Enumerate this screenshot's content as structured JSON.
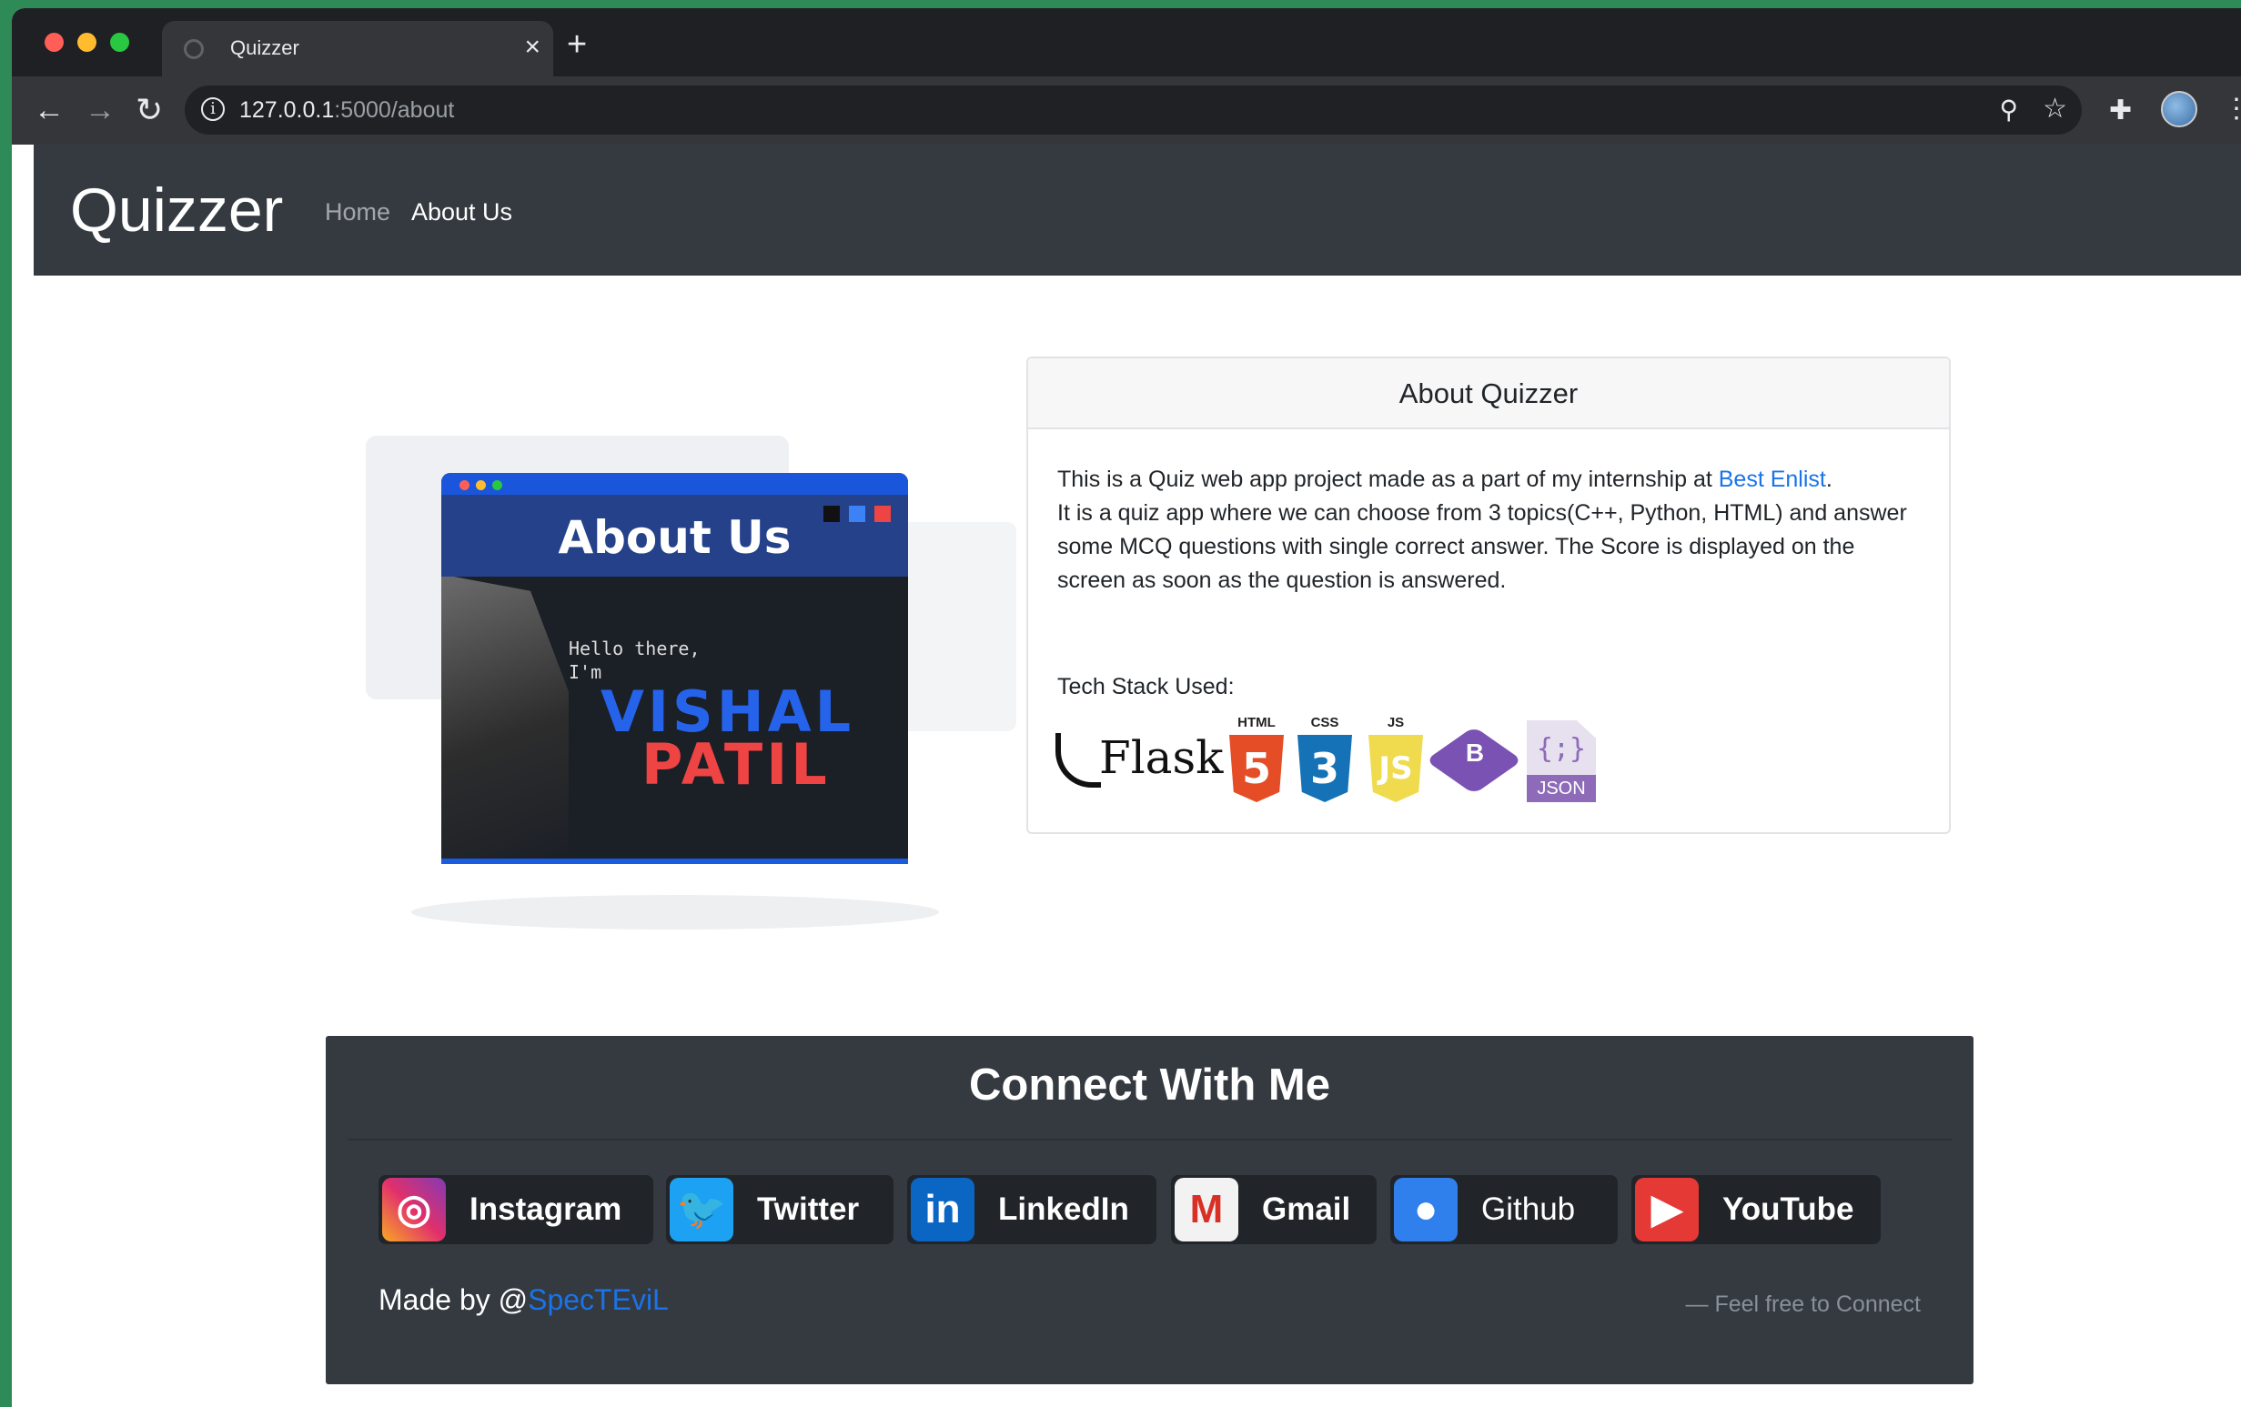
{
  "browser": {
    "tab_title": "Quizzer",
    "tab_close": "×",
    "new_tab": "+",
    "url_host": "127.0.0.1",
    "url_path": ":5000/about"
  },
  "navbar": {
    "brand": "Quizzer",
    "links": [
      {
        "label": "Home",
        "active": false
      },
      {
        "label": "About Us",
        "active": true
      }
    ]
  },
  "hero": {
    "title": "About Us",
    "hello_line1": "Hello there,",
    "hello_line2": "I'm",
    "name_first": "VISHAL",
    "name_last": "PATIL"
  },
  "about_card": {
    "title": "About Quizzer",
    "para1_prefix": "This is a Quiz web app project made as a part of my internship at ",
    "para1_link": "Best Enlist",
    "para1_suffix": ".",
    "para2": "It is a quiz app where we can choose from 3 topics(C++, Python, HTML) and answer some MCQ questions with single correct answer. The Score is displayed on the screen as soon as the question is answered.",
    "tech_label": "Tech Stack Used:",
    "tech": {
      "flask": "Flask",
      "html_label": "HTML",
      "html_num": "5",
      "css_label": "CSS",
      "css_num": "3",
      "js_label": "JS",
      "js_num": "JS",
      "bootstrap": "B",
      "json_braces": "{;}",
      "json_label": "JSON"
    }
  },
  "footer": {
    "heading": "Connect With Me",
    "socials": [
      {
        "name": "Instagram",
        "icon": "instagram-icon",
        "glyph": "◎"
      },
      {
        "name": "Twitter",
        "icon": "twitter-icon",
        "glyph": "🐦"
      },
      {
        "name": "LinkedIn",
        "icon": "linkedin-icon",
        "glyph": "in"
      },
      {
        "name": "Gmail",
        "icon": "gmail-icon",
        "glyph": "M"
      },
      {
        "name": "Github",
        "icon": "github-icon",
        "glyph": "●"
      },
      {
        "name": "YouTube",
        "icon": "youtube-icon",
        "glyph": "▶"
      }
    ],
    "made_by_prefix": "Made by @",
    "made_by_link": "SpecTEviL",
    "tagline": "— Feel free to Connect"
  }
}
